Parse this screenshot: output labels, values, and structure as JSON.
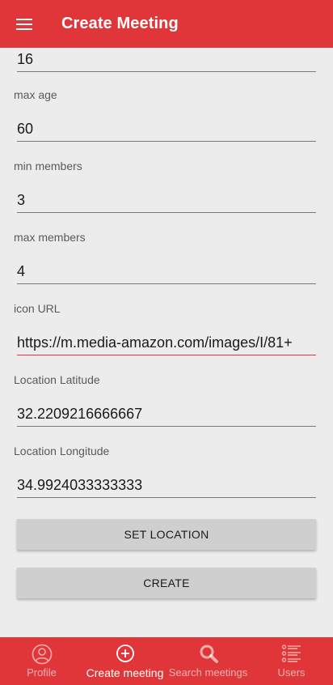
{
  "header": {
    "title": "Create Meeting",
    "menu_icon": "hamburger-menu-icon"
  },
  "form": {
    "fields": [
      {
        "label": "",
        "value": "16"
      },
      {
        "label": "max age",
        "value": "60"
      },
      {
        "label": "min members",
        "value": "3"
      },
      {
        "label": "max members",
        "value": "4"
      },
      {
        "label": "icon URL",
        "value": "https://m.media-amazon.com/images/I/81+"
      },
      {
        "label": "Location Latitude",
        "value": "32.2209216666667"
      },
      {
        "label": "Location Longitude",
        "value": "34.9924033333333"
      }
    ],
    "set_location_label": "SET LOCATION",
    "create_label": "CREATE"
  },
  "bottom_nav": {
    "items": [
      {
        "label": "Profile",
        "icon": "person-icon",
        "active": false
      },
      {
        "label": "Create meeting",
        "icon": "add-circle-icon",
        "active": true
      },
      {
        "label": "Search meetings",
        "icon": "search-icon",
        "active": false
      },
      {
        "label": "Users",
        "icon": "list-icon",
        "active": false
      }
    ]
  },
  "colors": {
    "primary": "#e0363a",
    "background": "#ececec",
    "button": "#cfcfcf"
  }
}
